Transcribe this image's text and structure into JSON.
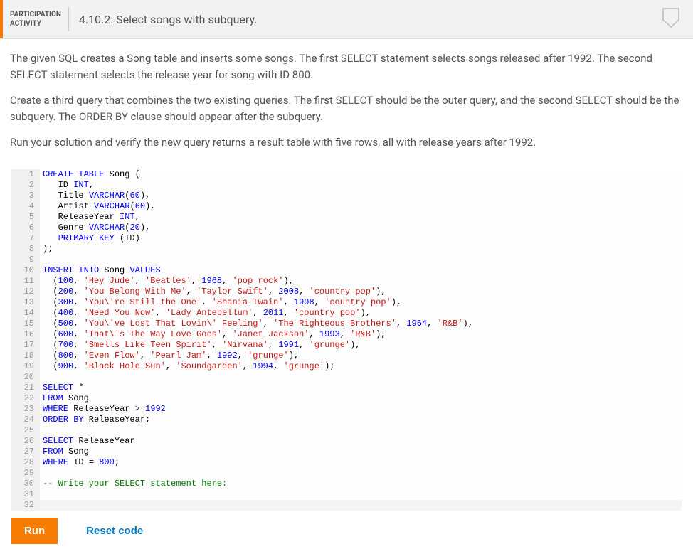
{
  "header": {
    "label_line1": "PARTICIPATION",
    "label_line2": "ACTIVITY",
    "title": "4.10.2: Select songs with subquery."
  },
  "instructions": {
    "p1": "The given SQL creates a Song table and inserts some songs. The first SELECT statement selects songs released after 1992. The second SELECT statement selects the release year for song with ID 800.",
    "p2": "Create a third query that combines the two existing queries. The first SELECT should be the outer query, and the second SELECT should be the subquery. The ORDER BY clause should appear after the subquery.",
    "p3": "Run your solution and verify the new query returns a result table with five rows, all with release years after 1992."
  },
  "code": {
    "lines": [
      [
        {
          "t": "CREATE TABLE",
          "c": "kw"
        },
        {
          "t": " Song ("
        }
      ],
      [
        {
          "t": "   ID "
        },
        {
          "t": "INT",
          "c": "typ"
        },
        {
          "t": ","
        }
      ],
      [
        {
          "t": "   Title "
        },
        {
          "t": "VARCHAR",
          "c": "typ"
        },
        {
          "t": "("
        },
        {
          "t": "60",
          "c": "num"
        },
        {
          "t": "),"
        }
      ],
      [
        {
          "t": "   Artist "
        },
        {
          "t": "VARCHAR",
          "c": "typ"
        },
        {
          "t": "("
        },
        {
          "t": "60",
          "c": "num"
        },
        {
          "t": "),"
        }
      ],
      [
        {
          "t": "   ReleaseYear "
        },
        {
          "t": "INT",
          "c": "typ"
        },
        {
          "t": ","
        }
      ],
      [
        {
          "t": "   Genre "
        },
        {
          "t": "VARCHAR",
          "c": "typ"
        },
        {
          "t": "("
        },
        {
          "t": "20",
          "c": "num"
        },
        {
          "t": "),"
        }
      ],
      [
        {
          "t": "   "
        },
        {
          "t": "PRIMARY KEY",
          "c": "kw"
        },
        {
          "t": " (ID)"
        }
      ],
      [
        {
          "t": ");"
        }
      ],
      [
        {
          "t": ""
        }
      ],
      [
        {
          "t": "INSERT",
          "c": "kw"
        },
        {
          "t": " "
        },
        {
          "t": "INTO",
          "c": "kw"
        },
        {
          "t": " Song "
        },
        {
          "t": "VALUES",
          "c": "kw"
        }
      ],
      [
        {
          "t": "  ("
        },
        {
          "t": "100",
          "c": "num"
        },
        {
          "t": ", "
        },
        {
          "t": "'Hey Jude'",
          "c": "str"
        },
        {
          "t": ", "
        },
        {
          "t": "'Beatles'",
          "c": "str"
        },
        {
          "t": ", "
        },
        {
          "t": "1968",
          "c": "num"
        },
        {
          "t": ", "
        },
        {
          "t": "'pop rock'",
          "c": "str"
        },
        {
          "t": "),"
        }
      ],
      [
        {
          "t": "  ("
        },
        {
          "t": "200",
          "c": "num"
        },
        {
          "t": ", "
        },
        {
          "t": "'You Belong With Me'",
          "c": "str"
        },
        {
          "t": ", "
        },
        {
          "t": "'Taylor Swift'",
          "c": "str"
        },
        {
          "t": ", "
        },
        {
          "t": "2008",
          "c": "num"
        },
        {
          "t": ", "
        },
        {
          "t": "'country pop'",
          "c": "str"
        },
        {
          "t": "),"
        }
      ],
      [
        {
          "t": "  ("
        },
        {
          "t": "300",
          "c": "num"
        },
        {
          "t": ", "
        },
        {
          "t": "'You\\'re Still the One'",
          "c": "str"
        },
        {
          "t": ", "
        },
        {
          "t": "'Shania Twain'",
          "c": "str"
        },
        {
          "t": ", "
        },
        {
          "t": "1998",
          "c": "num"
        },
        {
          "t": ", "
        },
        {
          "t": "'country pop'",
          "c": "str"
        },
        {
          "t": "),"
        }
      ],
      [
        {
          "t": "  ("
        },
        {
          "t": "400",
          "c": "num"
        },
        {
          "t": ", "
        },
        {
          "t": "'Need You Now'",
          "c": "str"
        },
        {
          "t": ", "
        },
        {
          "t": "'Lady Antebellum'",
          "c": "str"
        },
        {
          "t": ", "
        },
        {
          "t": "2011",
          "c": "num"
        },
        {
          "t": ", "
        },
        {
          "t": "'country pop'",
          "c": "str"
        },
        {
          "t": "),"
        }
      ],
      [
        {
          "t": "  ("
        },
        {
          "t": "500",
          "c": "num"
        },
        {
          "t": ", "
        },
        {
          "t": "'You\\'ve Lost That Lovin\\' Feeling'",
          "c": "str"
        },
        {
          "t": ", "
        },
        {
          "t": "'The Righteous Brothers'",
          "c": "str"
        },
        {
          "t": ", "
        },
        {
          "t": "1964",
          "c": "num"
        },
        {
          "t": ", "
        },
        {
          "t": "'R&B'",
          "c": "str"
        },
        {
          "t": "),"
        }
      ],
      [
        {
          "t": "  ("
        },
        {
          "t": "600",
          "c": "num"
        },
        {
          "t": ", "
        },
        {
          "t": "'That\\'s The Way Love Goes'",
          "c": "str"
        },
        {
          "t": ", "
        },
        {
          "t": "'Janet Jackson'",
          "c": "str"
        },
        {
          "t": ", "
        },
        {
          "t": "1993",
          "c": "num"
        },
        {
          "t": ", "
        },
        {
          "t": "'R&B'",
          "c": "str"
        },
        {
          "t": "),"
        }
      ],
      [
        {
          "t": "  ("
        },
        {
          "t": "700",
          "c": "num"
        },
        {
          "t": ", "
        },
        {
          "t": "'Smells Like Teen Spirit'",
          "c": "str"
        },
        {
          "t": ", "
        },
        {
          "t": "'Nirvana'",
          "c": "str"
        },
        {
          "t": ", "
        },
        {
          "t": "1991",
          "c": "num"
        },
        {
          "t": ", "
        },
        {
          "t": "'grunge'",
          "c": "str"
        },
        {
          "t": "),"
        }
      ],
      [
        {
          "t": "  ("
        },
        {
          "t": "800",
          "c": "num"
        },
        {
          "t": ", "
        },
        {
          "t": "'Even Flow'",
          "c": "str"
        },
        {
          "t": ", "
        },
        {
          "t": "'Pearl Jam'",
          "c": "str"
        },
        {
          "t": ", "
        },
        {
          "t": "1992",
          "c": "num"
        },
        {
          "t": ", "
        },
        {
          "t": "'grunge'",
          "c": "str"
        },
        {
          "t": "),"
        }
      ],
      [
        {
          "t": "  ("
        },
        {
          "t": "900",
          "c": "num"
        },
        {
          "t": ", "
        },
        {
          "t": "'Black Hole Sun'",
          "c": "str"
        },
        {
          "t": ", "
        },
        {
          "t": "'Soundgarden'",
          "c": "str"
        },
        {
          "t": ", "
        },
        {
          "t": "1994",
          "c": "num"
        },
        {
          "t": ", "
        },
        {
          "t": "'grunge'",
          "c": "str"
        },
        {
          "t": ");"
        }
      ],
      [
        {
          "t": ""
        }
      ],
      [
        {
          "t": "SELECT",
          "c": "kw"
        },
        {
          "t": " *"
        }
      ],
      [
        {
          "t": "FROM",
          "c": "kw"
        },
        {
          "t": " Song"
        }
      ],
      [
        {
          "t": "WHERE",
          "c": "kw"
        },
        {
          "t": " ReleaseYear > "
        },
        {
          "t": "1992",
          "c": "num"
        }
      ],
      [
        {
          "t": "ORDER BY",
          "c": "kw"
        },
        {
          "t": " ReleaseYear;"
        }
      ],
      [
        {
          "t": ""
        }
      ],
      [
        {
          "t": "SELECT",
          "c": "kw"
        },
        {
          "t": " ReleaseYear"
        }
      ],
      [
        {
          "t": "FROM",
          "c": "kw"
        },
        {
          "t": " Song"
        }
      ],
      [
        {
          "t": "WHERE",
          "c": "kw"
        },
        {
          "t": " ID = "
        },
        {
          "t": "800",
          "c": "num"
        },
        {
          "t": ";"
        }
      ],
      [
        {
          "t": ""
        }
      ],
      [
        {
          "t": "-- Write your SELECT statement here:",
          "c": "cmt"
        }
      ],
      [
        {
          "t": ""
        }
      ],
      [
        {
          "t": ""
        }
      ]
    ]
  },
  "actions": {
    "run": "Run",
    "reset": "Reset code"
  }
}
